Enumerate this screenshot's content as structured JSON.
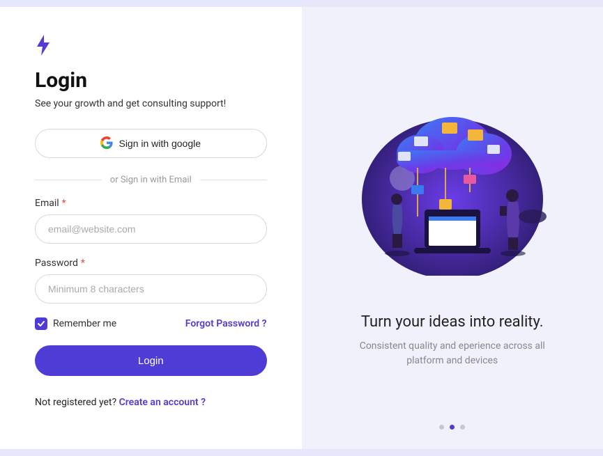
{
  "login": {
    "title": "Login",
    "subtitle": "See your growth and get consulting support!",
    "google_label": "Sign in with google",
    "divider_text": "or Sign in with Email",
    "email_label": "Email",
    "email_placeholder": "email@website.com",
    "password_label": "Password",
    "password_placeholder": "Minimum 8 characters",
    "required_mark": "*",
    "remember_label": "Remember me",
    "remember_checked": true,
    "forgot_label": "Forgot Password ?",
    "submit_label": "Login",
    "signup_prompt": "Not registered yet? ",
    "signup_link": "Create an account ?"
  },
  "hero": {
    "title": "Turn your ideas into reality.",
    "subtitle": "Consistent quality and eperience across all platform and devices"
  },
  "colors": {
    "accent": "#4f3bd5"
  },
  "carousel": {
    "total": 3,
    "active_index": 1
  }
}
